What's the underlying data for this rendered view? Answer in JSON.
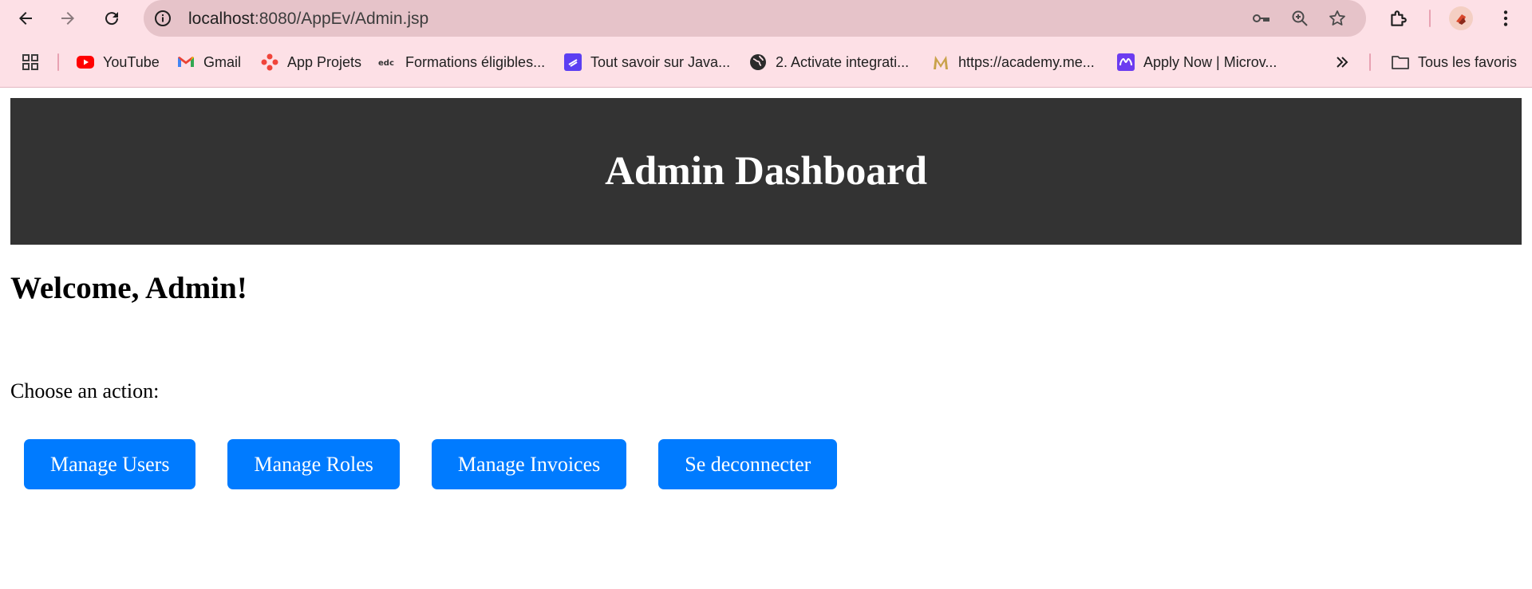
{
  "browser": {
    "url_host": "localhost",
    "url_path": ":8080/AppEv/Admin.jsp",
    "bookmarks": [
      {
        "label": "YouTube",
        "icon": "youtube-icon"
      },
      {
        "label": "Gmail",
        "icon": "gmail-icon"
      },
      {
        "label": "App Projets",
        "icon": "app-projets-icon"
      },
      {
        "label": "Formations éligibles...",
        "icon": "edc-icon"
      },
      {
        "label": "Tout savoir sur Java...",
        "icon": "bookmark-favicon-icon"
      },
      {
        "label": "2. Activate integrati...",
        "icon": "globe-icon"
      },
      {
        "label": "https://academy.me...",
        "icon": "academy-m-icon"
      },
      {
        "label": "Apply Now | Microv...",
        "icon": "microverse-icon"
      }
    ],
    "all_bookmarks_label": "Tous les favoris",
    "colors": {
      "chrome_bg": "#fde0e6",
      "omnibox_bg": "#e6c3c9"
    }
  },
  "page": {
    "header_title": "Admin Dashboard",
    "welcome": "Welcome, Admin!",
    "prompt": "Choose an action:",
    "actions": [
      "Manage Users",
      "Manage Roles",
      "Manage Invoices",
      "Se deconnecter"
    ],
    "colors": {
      "header_bg": "#333333",
      "button_bg": "#007bff"
    }
  }
}
